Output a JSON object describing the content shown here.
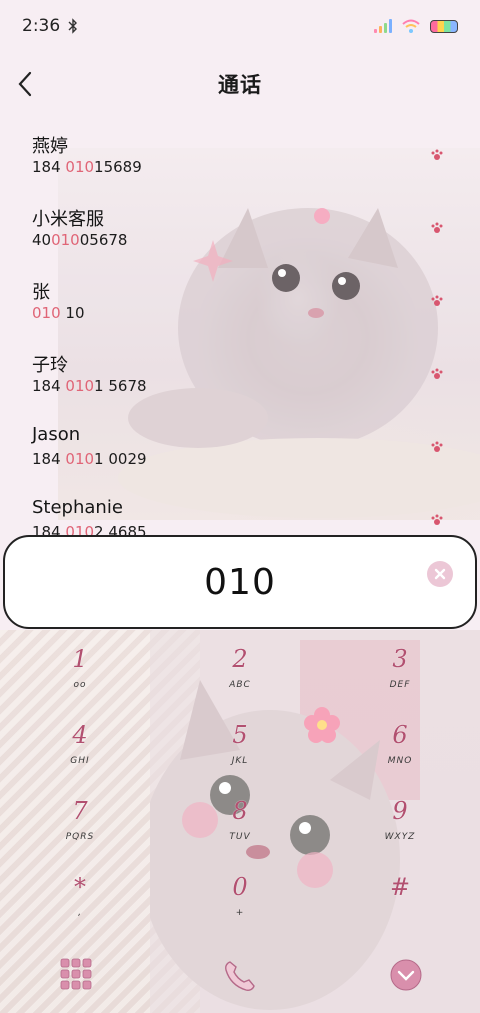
{
  "status": {
    "time": "2:36",
    "icons": [
      "bluetooth-icon",
      "signal-icon",
      "wifi-icon",
      "battery-icon"
    ]
  },
  "header": {
    "title": "通话",
    "back_icon": "chevron-left-icon"
  },
  "contacts": [
    {
      "name": "燕婷",
      "number_pre": "184 ",
      "number_hl": "010",
      "number_post": "15689"
    },
    {
      "name": "小米客服",
      "number_pre": "40",
      "number_hl": "010",
      "number_post": "05678"
    },
    {
      "name": "张",
      "number_pre": "",
      "number_hl": "010",
      "number_post": " 10"
    },
    {
      "name": "子玲",
      "number_pre": "184 ",
      "number_hl": "010",
      "number_post": "1 5678"
    },
    {
      "name": "Jason",
      "number_pre": "184 ",
      "number_hl": "010",
      "number_post": "1 0029"
    },
    {
      "name": "Stephanie",
      "number_pre": "184 ",
      "number_hl": "010",
      "number_post": "2 4685"
    }
  ],
  "dialer": {
    "value": "010",
    "clear_icon": "clear-icon"
  },
  "keypad": [
    {
      "digit": "1",
      "letters": "ᴏᴏ"
    },
    {
      "digit": "2",
      "letters": "ABC"
    },
    {
      "digit": "3",
      "letters": "DEF"
    },
    {
      "digit": "4",
      "letters": "GHI"
    },
    {
      "digit": "5",
      "letters": "JKL"
    },
    {
      "digit": "6",
      "letters": "MNO"
    },
    {
      "digit": "7",
      "letters": "PQRS"
    },
    {
      "digit": "8",
      "letters": "TUV"
    },
    {
      "digit": "9",
      "letters": "WXYZ"
    },
    {
      "digit": "*",
      "letters": ","
    },
    {
      "digit": "0",
      "letters": "+"
    },
    {
      "digit": "#",
      "letters": ""
    }
  ],
  "bottom_actions": [
    "dialpad-grid-icon",
    "phone-icon",
    "collapse-icon"
  ],
  "colors": {
    "accent": "#e06577",
    "key_digit": "#b25070",
    "background": "#f7eef3"
  }
}
